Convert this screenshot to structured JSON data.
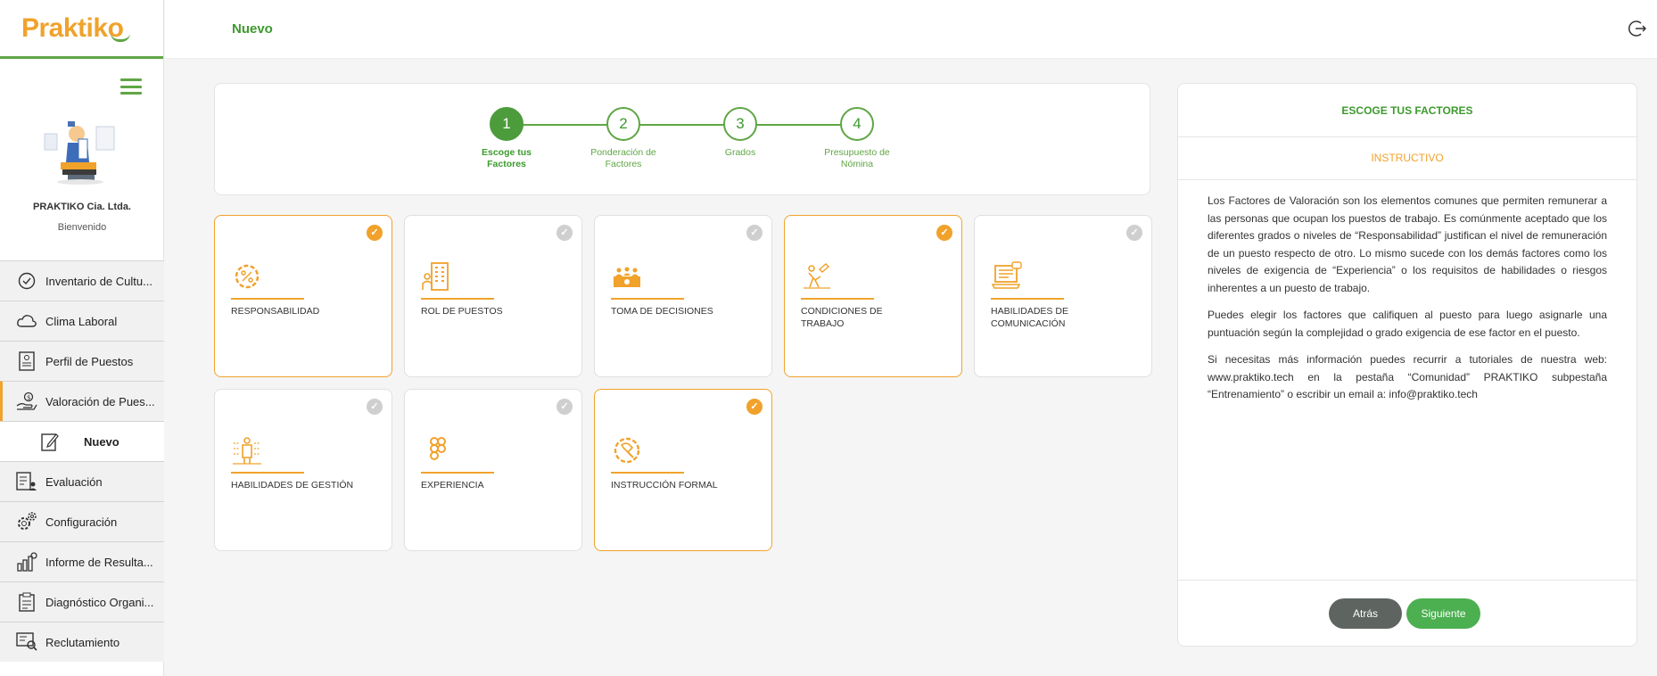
{
  "brand": {
    "logo_text": "Praktiko",
    "green": "#5fa645",
    "orange": "#f0a22b"
  },
  "user": {
    "company": "PRAKTIKO Cia. Ltda.",
    "greeting": "Bienvenido"
  },
  "sidebar": {
    "items": [
      {
        "label": "Inventario de Cultu...",
        "icon": "check-circle-icon"
      },
      {
        "label": "Clima Laboral",
        "icon": "cloud-icon"
      },
      {
        "label": "Perfil de Puestos",
        "icon": "document-person-icon"
      },
      {
        "label": "Valoración de Pues...",
        "icon": "hand-coin-icon",
        "active": true
      },
      {
        "label": "Nuevo",
        "icon": "edit-document-icon",
        "sub": true
      },
      {
        "label": "Evaluación",
        "icon": "checklist-person-icon"
      },
      {
        "label": "Configuración",
        "icon": "gears-icon"
      },
      {
        "label": "Informe de Resulta...",
        "icon": "bar-chart-icon"
      },
      {
        "label": "Diagnóstico Organi...",
        "icon": "clipboard-icon"
      },
      {
        "label": "Reclutamiento",
        "icon": "recruit-icon"
      }
    ]
  },
  "header": {
    "title": "Nuevo"
  },
  "stepper": {
    "steps": [
      {
        "number": "1",
        "label": "Escoge tus Factores",
        "done": true
      },
      {
        "number": "2",
        "label": "Ponderación de Factores"
      },
      {
        "number": "3",
        "label": "Grados"
      },
      {
        "number": "4",
        "label": "Presupuesto de Nómina"
      }
    ]
  },
  "factors": [
    {
      "label": "Responsabilidad",
      "selected": true,
      "icon": "gear-percent-icon"
    },
    {
      "label": "Rol de Puestos",
      "selected": false,
      "icon": "building-person-icon"
    },
    {
      "label": "Toma de Decisiones",
      "selected": false,
      "icon": "boardroom-icon"
    },
    {
      "label": "Condiciones de Trabajo",
      "selected": true,
      "icon": "worker-icon"
    },
    {
      "label": "Habilidades de Comunicación",
      "selected": false,
      "icon": "laptop-chat-icon"
    },
    {
      "label": "Habilidades de Gestión",
      "selected": false,
      "icon": "management-icon"
    },
    {
      "label": "Experiencia",
      "selected": false,
      "icon": "figma-icon"
    },
    {
      "label": "Instrucción Formal",
      "selected": true,
      "icon": "gear-wrench-icon"
    }
  ],
  "panel": {
    "title": "ESCOGE TUS FACTORES",
    "subtitle": "INSTRUCTIVO",
    "paragraphs": [
      "Los Factores de Valoración son los elementos comunes que permiten remunerar a las personas que ocupan los puestos de trabajo. Es comúnmente aceptado que los diferentes grados o niveles de “Responsabilidad” justifican el nivel de remuneración de un puesto respecto de otro. Lo mismo sucede con los demás factores como los niveles de exigencia de “Experiencia” o los requisitos de habilidades o riesgos inherentes a un puesto de trabajo.",
      "Puedes elegir los factores que califiquen al puesto para luego asignarle una puntuación según la complejidad o grado exigencia de ese factor en el puesto.",
      "Si necesitas más información puedes recurrir a tutoriales de nuestra web: www.praktiko.tech en la pestaña “Comunidad” PRAKTIKO subpestaña “Entrenamiento” o escribir un email a: info@praktiko.tech"
    ],
    "back_label": "Atrás",
    "next_label": "Siguiente"
  }
}
